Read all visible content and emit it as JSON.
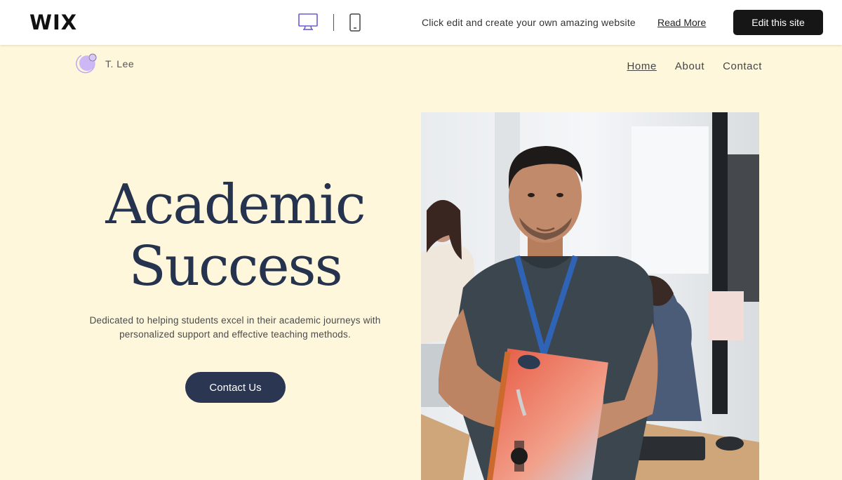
{
  "wix_bar": {
    "logo": "WIX",
    "device_icons": [
      "desktop-icon",
      "mobile-icon"
    ],
    "promo_text": "Click edit and create your own amazing website",
    "read_more": "Read More",
    "edit_button": "Edit this site"
  },
  "site": {
    "name": "T. Lee",
    "nav": [
      {
        "label": "Home",
        "active": true
      },
      {
        "label": "About",
        "active": false
      },
      {
        "label": "Contact",
        "active": false
      }
    ]
  },
  "hero": {
    "title_line1": "Academic",
    "title_line2": "Success",
    "description": "Dedicated to helping students excel in their academic journeys with personalized support and effective teaching methods.",
    "cta": "Contact Us"
  },
  "colors": {
    "page_bg": "#fff7dc",
    "navy": "#25334f",
    "button_dark": "#161616",
    "logo_purple": "#c9b6f2"
  }
}
